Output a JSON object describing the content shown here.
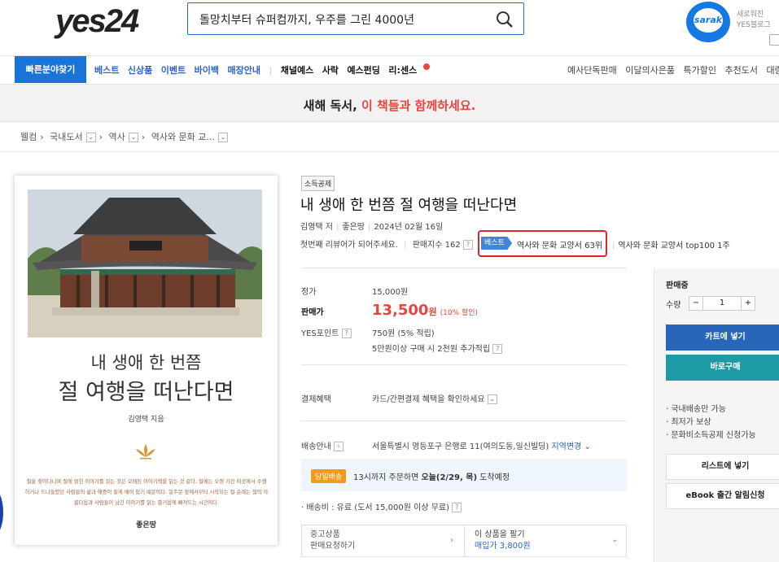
{
  "header": {
    "logo": "yes24",
    "search_value": "돌망치부터 슈퍼컴까지, 우주를 그린 4000년",
    "sarak_label": "sarak",
    "sarak_line1": "새로워진",
    "sarak_line2": "YES블로그"
  },
  "nav": {
    "quick_button": "빠른분야찾기",
    "blue_items": [
      "베스트",
      "신상품",
      "이벤트",
      "바이백",
      "매장안내"
    ],
    "black_items": [
      "채널예스",
      "사락",
      "예스펀딩",
      "리:센스"
    ],
    "right_items": [
      "예사단독판매",
      "이달의사은품",
      "특가할인",
      "추천도서",
      "대량구"
    ]
  },
  "banner": {
    "part1": "새해 독서, ",
    "part2": "이 책들과 함께하세요."
  },
  "breadcrumb": [
    "웰컴",
    "국내도서",
    "역사",
    "역사와 문화 교..."
  ],
  "cover": {
    "title1": "내 생애 한 번쯤",
    "title2": "절 여행을 떠난다면",
    "author": "김영택 지음",
    "desc": "절을 찾아다니며 절에 얽힌 이야기를 읽는 것은 오래된 이야기책을 읽는 것 같다. 절에는 오랜 기간 이곳에서 수행하거나 드나들었던 사람들의 삶과 애증이 짙게 배어 있기 때문이다. 일주문 앞에서부터 시작되는 절 순례는 절의 아름다움과 사람들이 남긴 이야기를 읽는 즐거움에 빠져드는 시간이다.",
    "publisher": "좋은땅"
  },
  "product": {
    "tag": "소득공제",
    "title": "내 생애 한 번쯤 절 여행을 떠난다면",
    "author": "김영택 저",
    "publisher": "좋은땅",
    "date": "2024년 02월 16일",
    "review": "첫번째 리뷰어가 되어주세요.",
    "sales_index": "판매지수 162",
    "best_label": "베스트",
    "best_rank": "역사와 문화 교양서 63위",
    "best_rank2": "역사와 문화 교양서 top100 1주"
  },
  "price": {
    "list_label": "정가",
    "list_value": "15,000원",
    "sale_label": "판매가",
    "sale_value": "13,500",
    "sale_unit": "원",
    "discount": "(10% 할인)",
    "point_label": "YES포인트",
    "point_value": "750원 (5% 적립)",
    "point_extra": "5만원이상 구매 시 2천원 추가적립"
  },
  "payment": {
    "label": "결제혜택",
    "value": "카드/간편결제 혜택을 확인하세요"
  },
  "delivery": {
    "label": "배송안내",
    "address": "서울특별시 영등포구 은행로 11(여의도동,일신빌딩)",
    "change": "지역변경",
    "badge": "당일배송",
    "text1": "13시까지 주문하면 ",
    "text2": "오늘(2/29, 목)",
    "text3": " 도착예정",
    "fee": "배송비 : 유료 (도서 15,000원 이상 무료)"
  },
  "used": {
    "line1": "중고상품",
    "line2": "판매요청하기",
    "sell_line1": "이 상품을 팔기",
    "sell_line2": "매입가 3,800원"
  },
  "panel": {
    "status": "판매중",
    "qty_label": "수량",
    "qty_minus": "−",
    "qty": "1",
    "qty_plus": "+",
    "cart": "카트에 넣기",
    "buy": "바로구매",
    "bullets": [
      "· 국내배송만 가능",
      "· 최저가 보상",
      "· 문화비소득공제 신청가능"
    ],
    "list_btn": "리스트에 넣기",
    "ebook_btn": "eBook 출간 알림신청"
  },
  "colors": {
    "brand_blue": "#1a73d9",
    "price_red": "#e5463e",
    "buy_teal": "#1e9aa7",
    "best_red": "#d8262c"
  }
}
